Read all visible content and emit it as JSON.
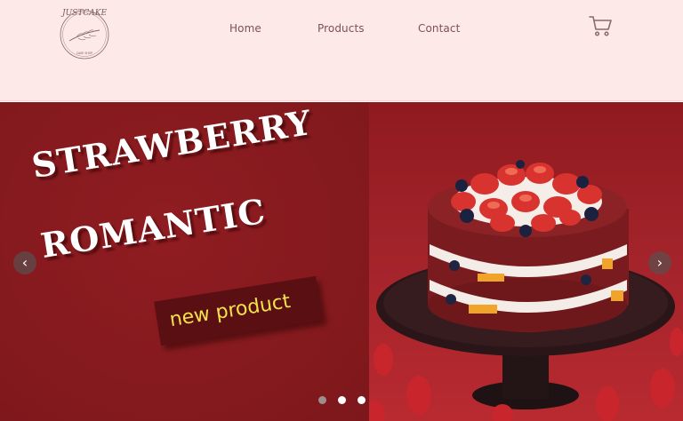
{
  "header": {
    "logo": {
      "icon": "cake-shop-logo",
      "text_top": "JUSTCAKE",
      "text_bottom": "CAKE SHOP"
    },
    "nav": [
      {
        "label": "Home"
      },
      {
        "label": "Products"
      },
      {
        "label": "Contact"
      }
    ],
    "cart": {
      "icon": "shopping-cart-icon"
    }
  },
  "hero": {
    "headline_line1": "STRAWBERRY",
    "headline_line2": "ROMANTIC",
    "tag": "new product",
    "image": "strawberry-red-velvet-cake",
    "prev_arrow": "‹",
    "next_arrow": "›",
    "slide_count": 3,
    "active_slide": 1
  },
  "colors": {
    "header_bg": "#fde9e8",
    "nav_text": "#7d5251",
    "hero_bg": "#871a1f",
    "tag_bg": "#5a0f13",
    "tag_text": "#f2e24b",
    "headline_text": "#ffffff"
  }
}
